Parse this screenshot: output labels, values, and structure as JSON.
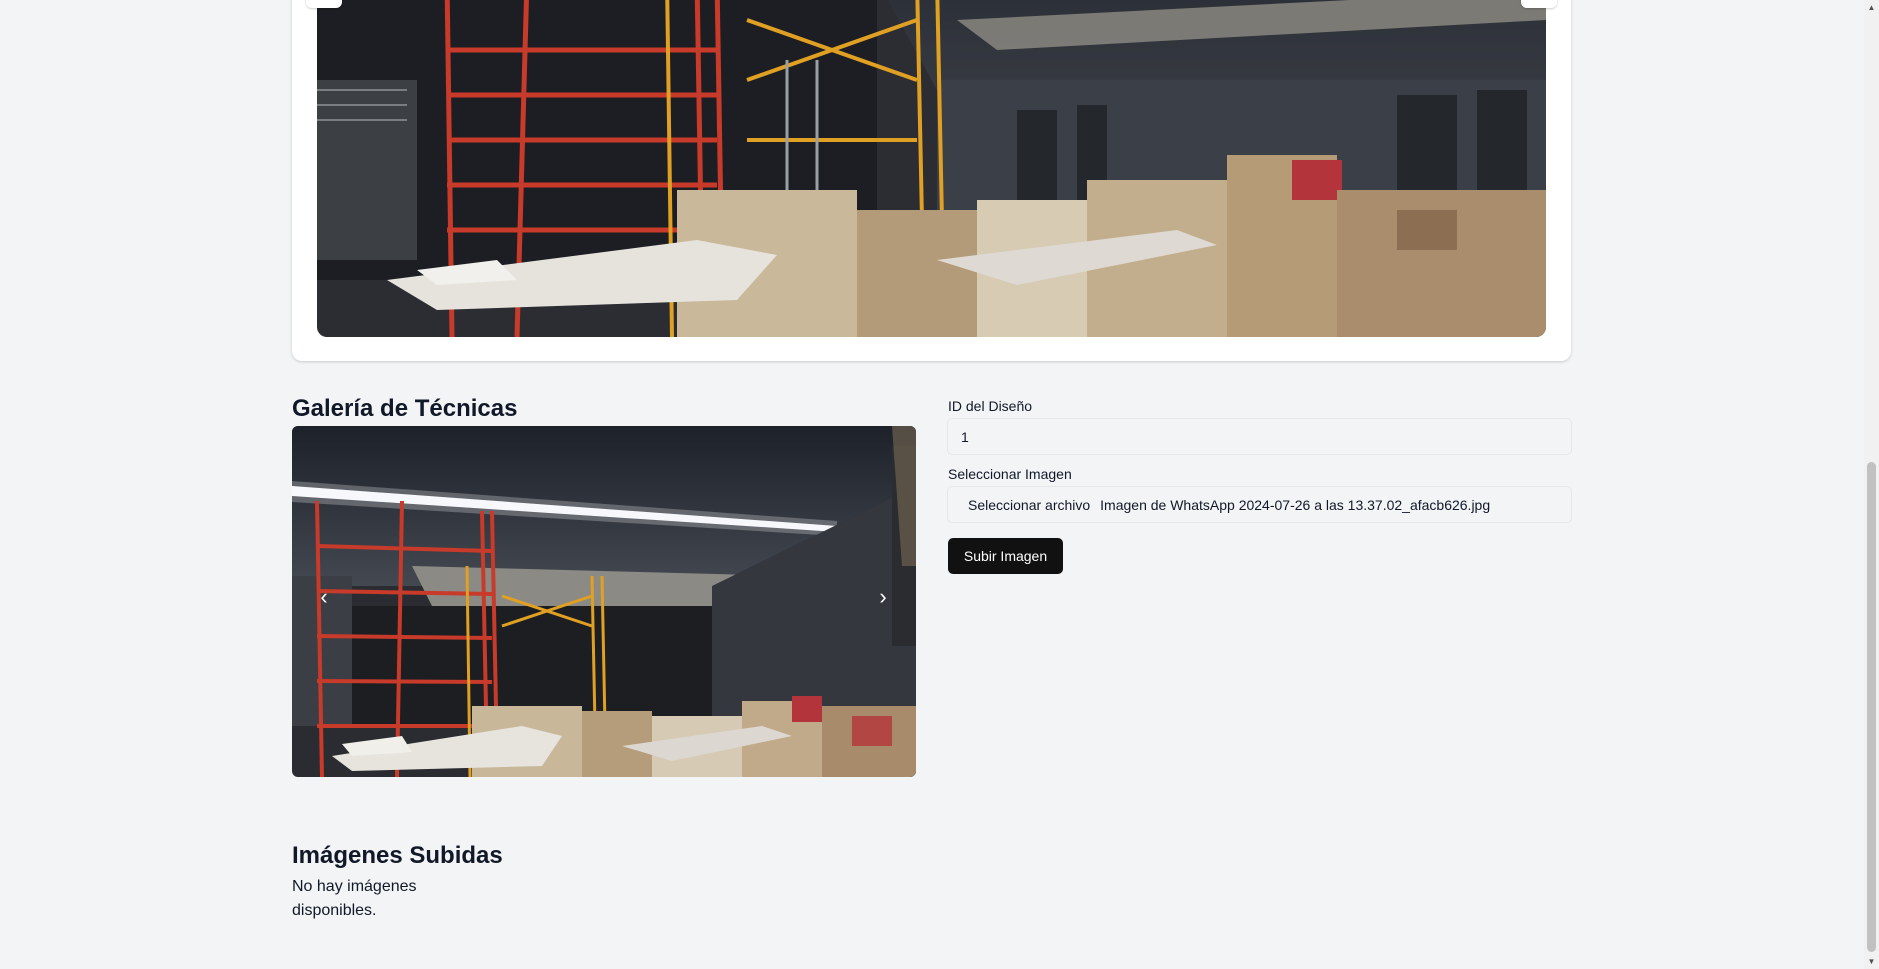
{
  "gallery": {
    "title": "Galería de Técnicas",
    "prev_icon": "‹",
    "next_icon": "›"
  },
  "form": {
    "design_id_label": "ID del Diseño",
    "design_id_value": "1",
    "image_label": "Seleccionar Imagen",
    "file_button_label": "Seleccionar archivo",
    "file_name": "Imagen de WhatsApp 2024-07-26 a las 13.37.02_afacb626.jpg",
    "submit_label": "Subir Imagen"
  },
  "uploaded": {
    "title": "Imágenes Subidas",
    "empty_message": "No hay imágenes disponibles."
  },
  "colors": {
    "background": "#f3f4f6",
    "button": "#111111",
    "scaffold_red": "#c83a2a",
    "scaffold_yellow": "#e0a023"
  }
}
